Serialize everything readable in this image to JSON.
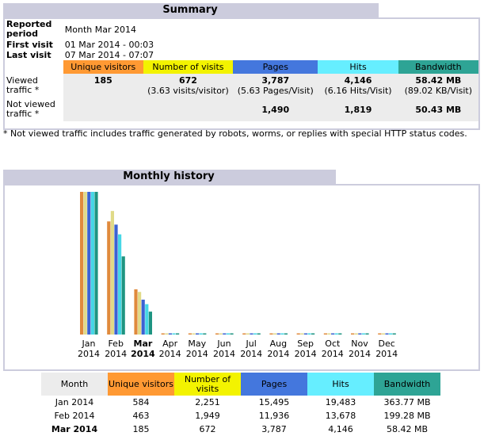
{
  "summary": {
    "title": "Summary",
    "reported_period_label": "Reported period",
    "reported_period_value": "Month Mar 2014",
    "first_visit_label": "First visit",
    "first_visit_value": "01 Mar 2014 - 00:03",
    "last_visit_label": "Last visit",
    "last_visit_value": "07 Mar 2014 - 07:07",
    "headers": {
      "unique": "Unique visitors",
      "visits": "Number of visits",
      "pages": "Pages",
      "hits": "Hits",
      "bandwidth": "Bandwidth"
    },
    "viewed": {
      "label": "Viewed traffic *",
      "unique": "185",
      "visits": "672",
      "visits_sub": "(3.63 visits/visitor)",
      "pages": "3,787",
      "pages_sub": "(5.63 Pages/Visit)",
      "hits": "4,146",
      "hits_sub": "(6.16 Hits/Visit)",
      "bandwidth": "58.42 MB",
      "bandwidth_sub": "(89.02 KB/Visit)"
    },
    "not_viewed": {
      "label": "Not viewed traffic *",
      "pages": "1,490",
      "hits": "1,819",
      "bandwidth": "50.43 MB"
    },
    "note": "* Not viewed traffic includes traffic generated by robots, worms, or replies with special HTTP status codes."
  },
  "monthly": {
    "title": "Monthly history",
    "headers": {
      "month": "Month",
      "unique": "Unique visitors",
      "visits": "Number of visits",
      "pages": "Pages",
      "hits": "Hits",
      "bandwidth": "Bandwidth"
    },
    "rows": [
      {
        "month": "Jan 2014",
        "unique": "584",
        "visits": "2,251",
        "pages": "15,495",
        "hits": "19,483",
        "bandwidth": "363.77 MB",
        "bold": false
      },
      {
        "month": "Feb 2014",
        "unique": "463",
        "visits": "1,949",
        "pages": "11,936",
        "hits": "13,678",
        "bandwidth": "199.28 MB",
        "bold": false
      },
      {
        "month": "Mar 2014",
        "unique": "185",
        "visits": "672",
        "pages": "3,787",
        "hits": "4,146",
        "bandwidth": "58.42 MB",
        "bold": true
      }
    ]
  },
  "chart_data": {
    "type": "bar",
    "categories": [
      "Jan 2014",
      "Feb 2014",
      "Mar 2014",
      "Apr 2014",
      "May 2014",
      "Jun 2014",
      "Jul 2014",
      "Aug 2014",
      "Sep 2014",
      "Oct 2014",
      "Nov 2014",
      "Dec 2014"
    ],
    "category_month": [
      "Jan",
      "Feb",
      "Mar",
      "Apr",
      "May",
      "Jun",
      "Jul",
      "Aug",
      "Sep",
      "Oct",
      "Nov",
      "Dec"
    ],
    "category_year": [
      "2014",
      "2014",
      "2014",
      "2014",
      "2014",
      "2014",
      "2014",
      "2014",
      "2014",
      "2014",
      "2014",
      "2014"
    ],
    "highlight_index": 2,
    "series": [
      {
        "key": "unique",
        "color": "#e08a3c",
        "values": [
          584,
          463,
          185,
          0,
          0,
          0,
          0,
          0,
          0,
          0,
          0,
          0
        ]
      },
      {
        "key": "visits",
        "color": "#e0da88",
        "values": [
          2251,
          1949,
          672,
          0,
          0,
          0,
          0,
          0,
          0,
          0,
          0,
          0
        ]
      },
      {
        "key": "pages",
        "color": "#3b62d3",
        "values": [
          15495,
          11936,
          3787,
          0,
          0,
          0,
          0,
          0,
          0,
          0,
          0,
          0
        ]
      },
      {
        "key": "hits",
        "color": "#46d7e6",
        "values": [
          19483,
          13678,
          4146,
          0,
          0,
          0,
          0,
          0,
          0,
          0,
          0,
          0
        ]
      },
      {
        "key": "bandwidth",
        "color": "#1e9481",
        "values": [
          363.77,
          199.28,
          58.42,
          0,
          0,
          0,
          0,
          0,
          0,
          0,
          0,
          0
        ]
      }
    ]
  },
  "colors": {
    "title_bg": "#ccccdd",
    "unique": "#ff9933",
    "visits": "#f3f300",
    "pages": "#4477dd",
    "hits": "#66eeff",
    "bandwidth": "#2ea495"
  }
}
